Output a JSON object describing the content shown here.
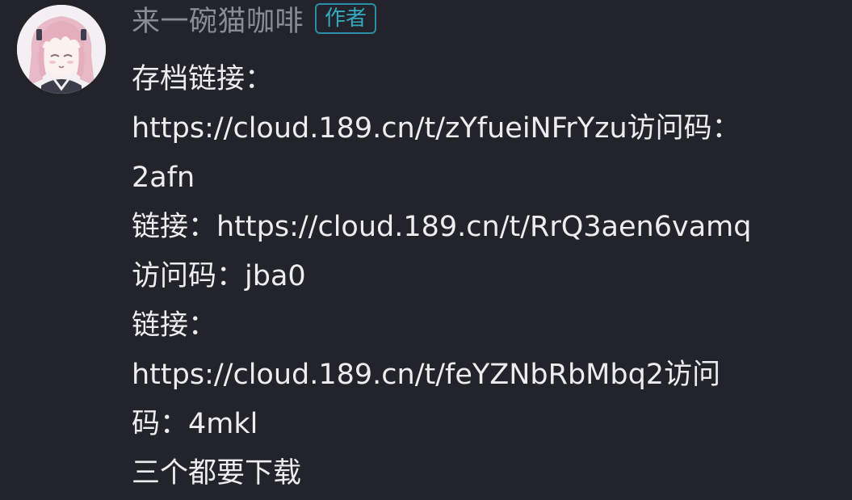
{
  "comment": {
    "username": "来一碗猫咖啡",
    "author_badge": "作者",
    "lines": [
      "存档链接：",
      "https://cloud.189.cn/t/zYfueiNFrYzu访问码：",
      "2afn",
      "链接：https://cloud.189.cn/t/RrQ3aen6vamq",
      "访问码：jba0",
      "链接：",
      "https://cloud.189.cn/t/feYZNbRbMbq2访问",
      "码：4mkl",
      "三个都要下载"
    ]
  },
  "colors": {
    "background": "#22232b",
    "username": "#8a8b94",
    "badge": "#34a9bf",
    "text": "#ececf1"
  },
  "icons": {
    "avatar": "anime-girl-avatar"
  }
}
